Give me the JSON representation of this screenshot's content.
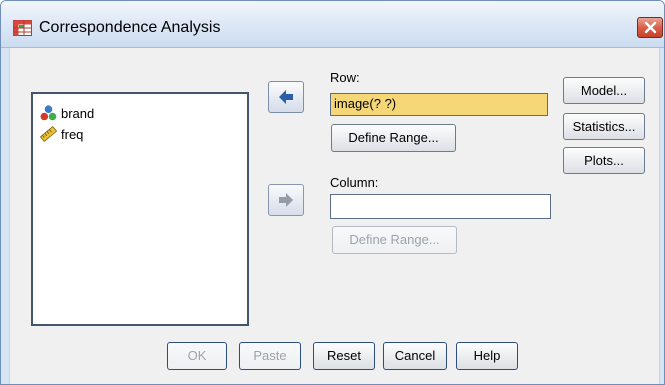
{
  "window": {
    "title": "Correspondence Analysis",
    "app_icon": "table-grid-icon",
    "close_icon": "close-x-icon"
  },
  "variables": [
    {
      "name": "brand",
      "icon": "nominal-measure-icon"
    },
    {
      "name": "freq",
      "icon": "scale-ruler-icon"
    }
  ],
  "row": {
    "label": "Row:",
    "value": "image(? ?)",
    "define_range_label": "Define Range...",
    "move_button_icon": "arrow-left-icon"
  },
  "column": {
    "label": "Column:",
    "value": "",
    "define_range_label": "Define Range...",
    "move_button_icon": "arrow-right-icon"
  },
  "side_buttons": {
    "model": "Model...",
    "statistics": "Statistics...",
    "plots": "Plots..."
  },
  "bottom_buttons": {
    "ok": "OK",
    "paste": "Paste",
    "reset": "Reset",
    "cancel": "Cancel",
    "help": "Help"
  },
  "colors": {
    "selected_field": "#f5d778",
    "title_gradient_bottom": "#cbdcf1",
    "close_button": "#d9604a",
    "arrow_active": "#2a5fa8",
    "arrow_disabled": "#8a94a0"
  }
}
